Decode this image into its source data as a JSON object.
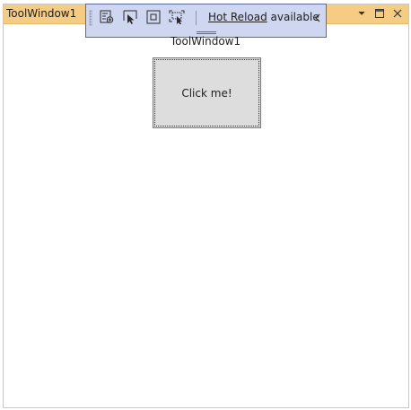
{
  "window": {
    "title": "ToolWindow1",
    "title_bar_color": "#f5cc84",
    "controls": [
      "chevron-down-icon",
      "maximize-icon",
      "close-icon"
    ]
  },
  "toolbar": {
    "buttons": [
      "live-visual-tree-icon",
      "select-element-icon",
      "display-layout-adorners-icon",
      "track-focus-icon"
    ],
    "hot_reload_link": "Hot Reload",
    "hot_reload_status": " available",
    "background": "#cfd6f0"
  },
  "content": {
    "label": "ToolWindow1",
    "button_label": "Click me!"
  }
}
